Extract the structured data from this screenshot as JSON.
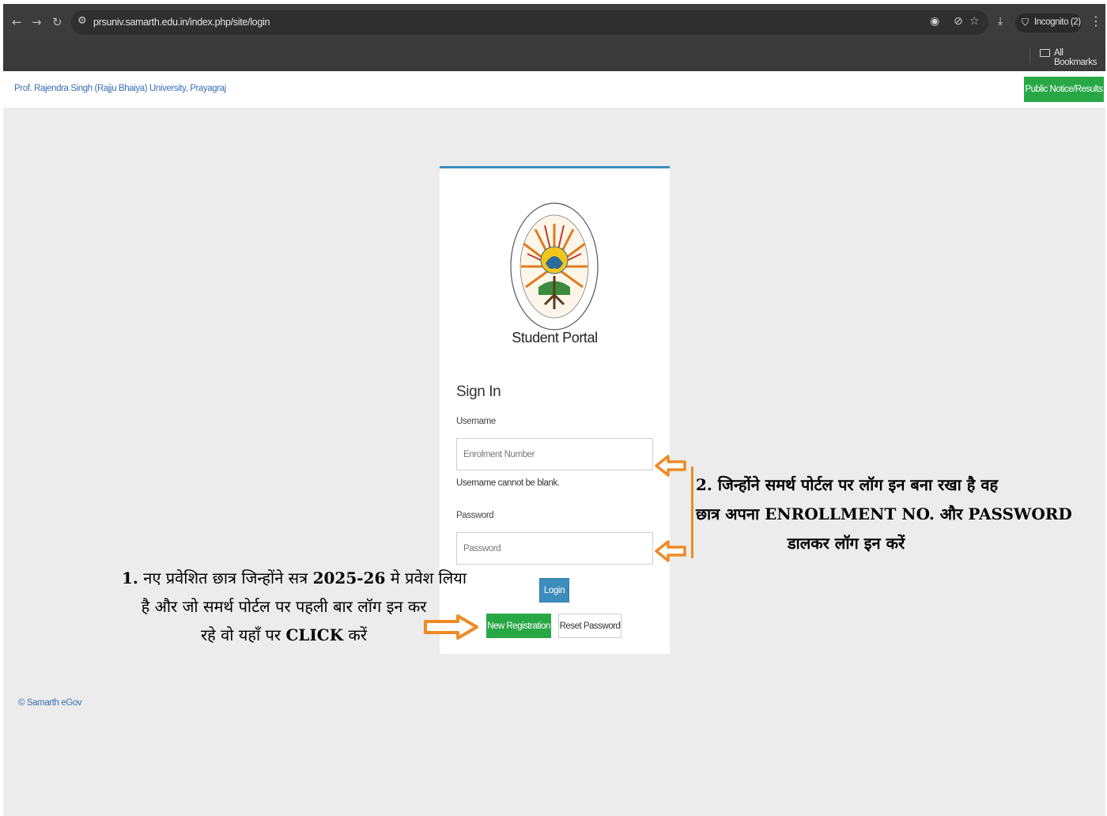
{
  "browser": {
    "url": "prsuniv.samarth.edu.in/index.php/site/login",
    "incognito_label": "Incognito (2)",
    "bookmarks_label": "All Bookmarks",
    "icons": [
      "back-icon",
      "forward-icon",
      "reload-icon",
      "site-settings-icon",
      "eye-off-icon",
      "tracking-off-icon",
      "star-icon",
      "download-icon",
      "incognito-icon",
      "menu-icon",
      "folder-icon"
    ]
  },
  "header": {
    "university_name": "Prof. Rajendra Singh (Rajju Bhaiya) University, Prayagraj",
    "notice_button": "Public Notice/Results"
  },
  "login": {
    "portal_title": "Student Portal",
    "heading": "Sign In",
    "username_label": "Username",
    "username_placeholder": "Enrolment Number",
    "username_error": "Username cannot be blank.",
    "password_label": "Password",
    "password_placeholder": "Password",
    "login_button": "Login",
    "new_registration_button": "New Registration",
    "reset_password_button": "Reset Password"
  },
  "footer": {
    "copyright": "© Samarth eGov"
  },
  "annotations": {
    "note1": {
      "number": "1.",
      "line1": "नए प्रवेशित छात्र जिन्होंने सत्र",
      "year": "2025-26",
      "line1_end": "मे प्रवेश लिया",
      "line2": "है और जो समर्थ पोर्टल पर पहली बार लॉग इन कर",
      "line3_start": "रहे वो यहाँ पर",
      "line3_em": "CLICK",
      "line3_end": "करें"
    },
    "note2": {
      "line1": "2. जिन्होंने समर्थ पोर्टल पर लॉग इन बना रखा है वह",
      "line2_start": "छात्र अपना",
      "line2_em1": "ENROLLMENT NO.",
      "line2_mid": "और",
      "line2_em2": "PASSWORD",
      "line3": "डालकर लॉग इन करें"
    },
    "arrow_color": "#f08a24"
  }
}
